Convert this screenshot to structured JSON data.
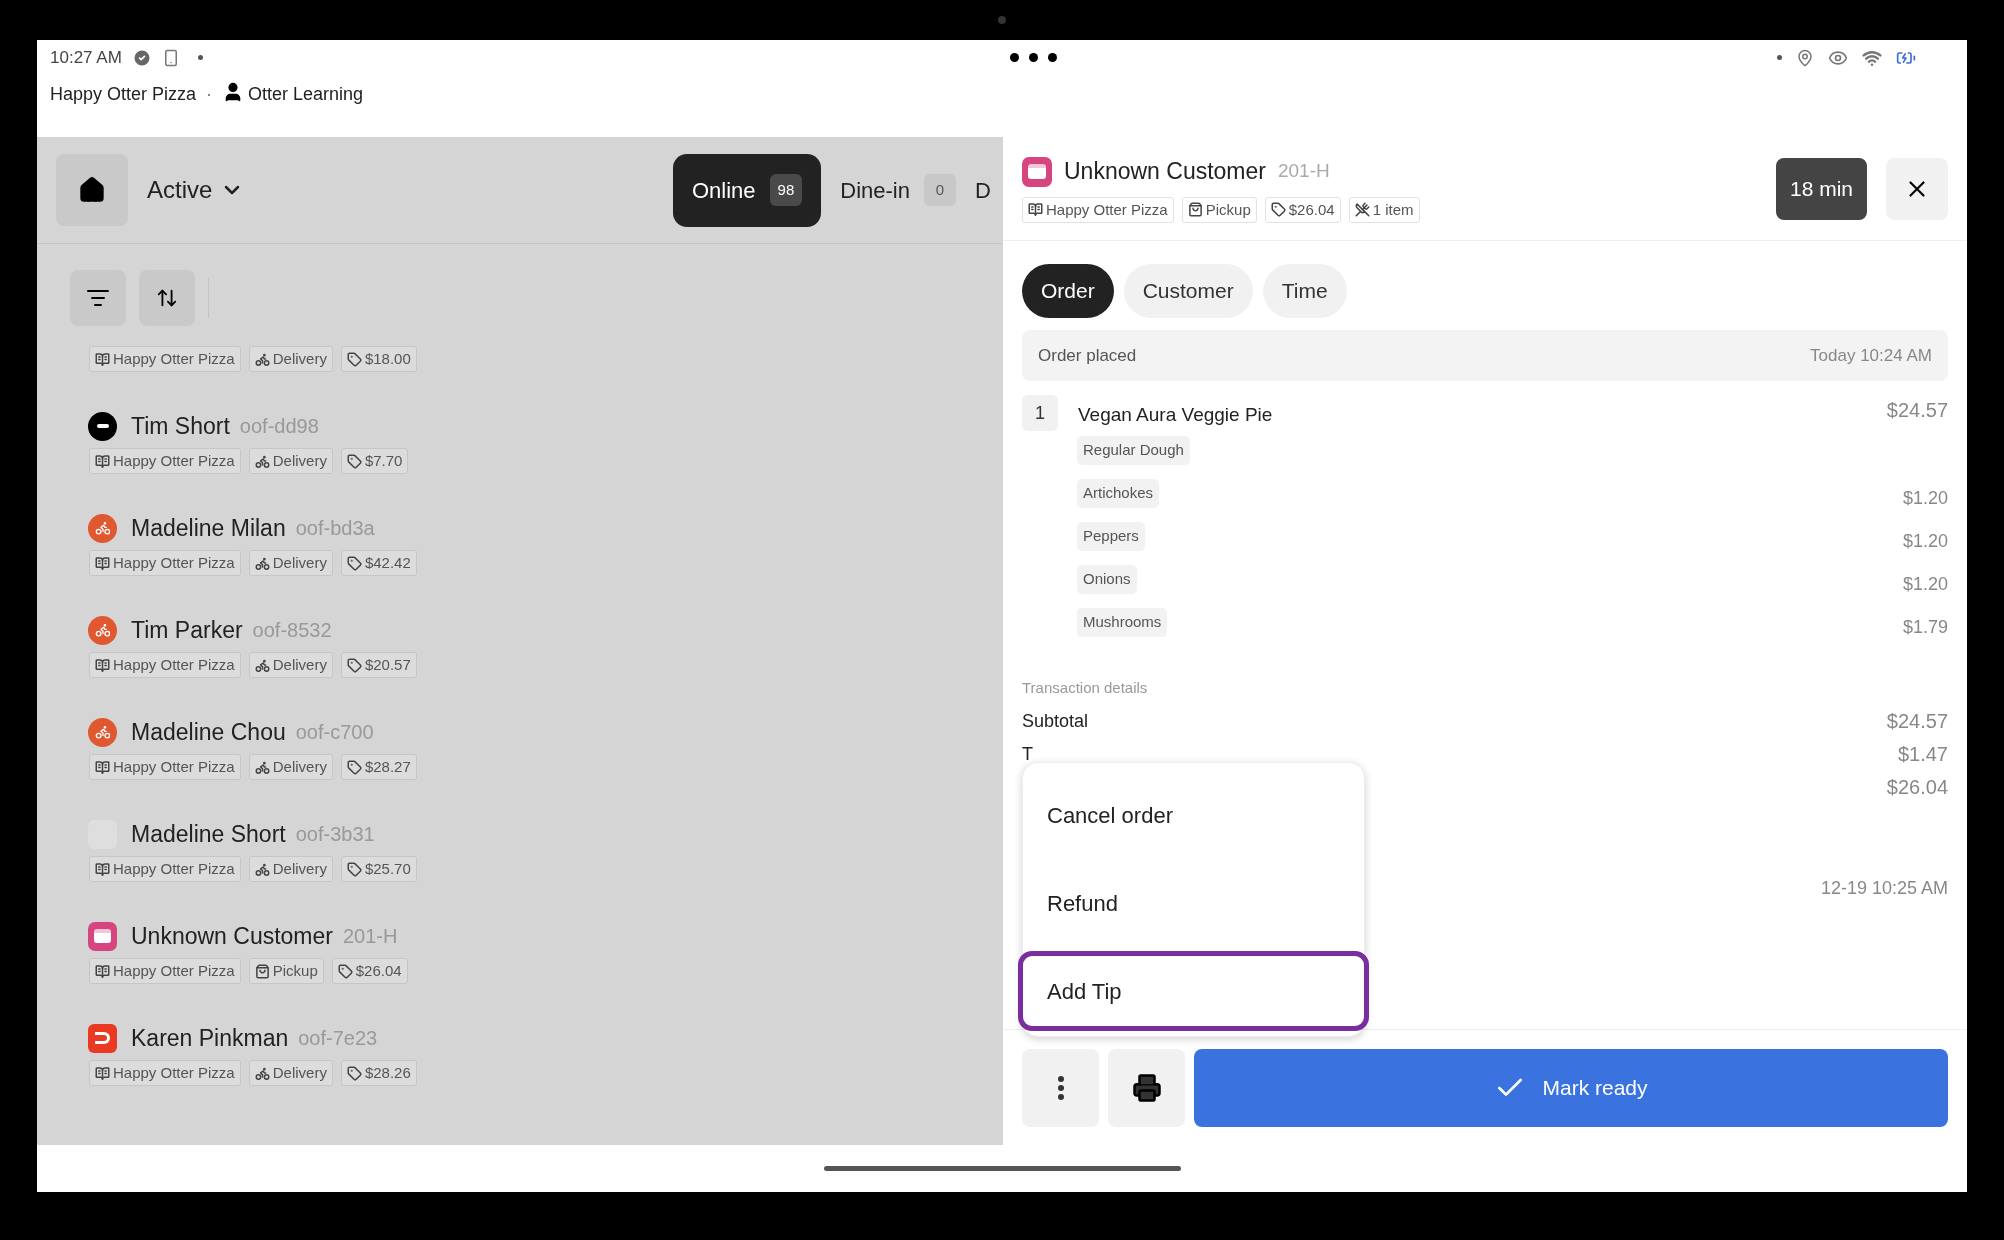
{
  "status_bar": {
    "time": "10:27 AM"
  },
  "location": {
    "store": "Happy Otter Pizza",
    "separator": "·",
    "user": "Otter Learning"
  },
  "orders_panel": {
    "filter": "Active",
    "channel_tabs": [
      {
        "label": "Online",
        "count": "98",
        "selected": true
      },
      {
        "label": "Dine-in",
        "count": "0",
        "selected": false
      },
      {
        "label": "D",
        "selected": false
      }
    ],
    "orders": [
      {
        "tags": [
          {
            "kind": "store",
            "label": "Happy Otter Pizza"
          },
          {
            "kind": "delivery",
            "label": "Delivery"
          },
          {
            "kind": "price",
            "label": "$18.00"
          }
        ]
      },
      {
        "kind": "black",
        "name": "Tim Short",
        "code": "oof-dd98",
        "tags": [
          {
            "kind": "store",
            "label": "Happy Otter Pizza"
          },
          {
            "kind": "delivery",
            "label": "Delivery"
          },
          {
            "kind": "price",
            "label": "$7.70"
          }
        ]
      },
      {
        "kind": "courier",
        "name": "Madeline Milan",
        "code": "oof-bd3a",
        "tags": [
          {
            "kind": "store",
            "label": "Happy Otter Pizza"
          },
          {
            "kind": "delivery",
            "label": "Delivery"
          },
          {
            "kind": "price",
            "label": "$42.42"
          }
        ]
      },
      {
        "kind": "courier",
        "name": "Tim Parker",
        "code": "oof-8532",
        "tags": [
          {
            "kind": "store",
            "label": "Happy Otter Pizza"
          },
          {
            "kind": "delivery",
            "label": "Delivery"
          },
          {
            "kind": "price",
            "label": "$20.57"
          }
        ]
      },
      {
        "kind": "courier",
        "name": "Madeline Chou",
        "code": "oof-c700",
        "tags": [
          {
            "kind": "store",
            "label": "Happy Otter Pizza"
          },
          {
            "kind": "delivery",
            "label": "Delivery"
          },
          {
            "kind": "price",
            "label": "$28.27"
          }
        ]
      },
      {
        "kind": "blank",
        "name": "Madeline Short",
        "code": "oof-3b31",
        "tags": [
          {
            "kind": "store",
            "label": "Happy Otter Pizza"
          },
          {
            "kind": "delivery",
            "label": "Delivery"
          },
          {
            "kind": "price",
            "label": "$25.70"
          }
        ]
      },
      {
        "kind": "card",
        "name": "Unknown Customer",
        "code": "201-H",
        "tags": [
          {
            "kind": "store",
            "label": "Happy Otter Pizza"
          },
          {
            "kind": "pickup",
            "label": "Pickup"
          },
          {
            "kind": "price",
            "label": "$26.04"
          }
        ]
      },
      {
        "kind": "dash",
        "name": "Karen Pinkman",
        "code": "oof-7e23",
        "tags": [
          {
            "kind": "store",
            "label": "Happy Otter Pizza"
          },
          {
            "kind": "delivery",
            "label": "Delivery"
          },
          {
            "kind": "price",
            "label": "$28.26"
          }
        ]
      }
    ]
  },
  "order_detail": {
    "kind": "card",
    "name": "Unknown Customer",
    "code": "201-H",
    "timer": "18 min",
    "tags": [
      {
        "kind": "store",
        "label": "Happy Otter Pizza"
      },
      {
        "kind": "pickup",
        "label": "Pickup"
      },
      {
        "kind": "price",
        "label": "$26.04"
      },
      {
        "kind": "items",
        "label": "1 item"
      }
    ],
    "tabs": [
      {
        "label": "Order",
        "selected": true
      },
      {
        "label": "Customer",
        "selected": false
      },
      {
        "label": "Time",
        "selected": false
      }
    ],
    "placed": {
      "label": "Order placed",
      "time": "Today 10:24 AM"
    },
    "item": {
      "quantity": "1",
      "name": "Vegan Aura Veggie Pie",
      "price": "$24.57",
      "modifiers": [
        {
          "name": "Regular Dough"
        },
        {
          "name": "Artichokes",
          "price": "$1.20"
        },
        {
          "name": "Peppers",
          "price": "$1.20"
        },
        {
          "name": "Onions",
          "price": "$1.20"
        },
        {
          "name": "Mushrooms",
          "price": "$1.79"
        }
      ]
    },
    "transaction": {
      "title": "Transaction details",
      "rows": [
        {
          "label": "Subtotal",
          "value": "$24.57"
        },
        {
          "label": "T",
          "value": "$1.47"
        },
        {
          "value": "$26.04"
        }
      ],
      "timestamp": "12-19 10:25 AM"
    },
    "menu": [
      {
        "label": "Cancel order",
        "highlighted": false
      },
      {
        "label": "Refund",
        "highlighted": false
      },
      {
        "label": "Add Tip",
        "highlighted": true
      }
    ],
    "primary_action": "Mark ready"
  }
}
